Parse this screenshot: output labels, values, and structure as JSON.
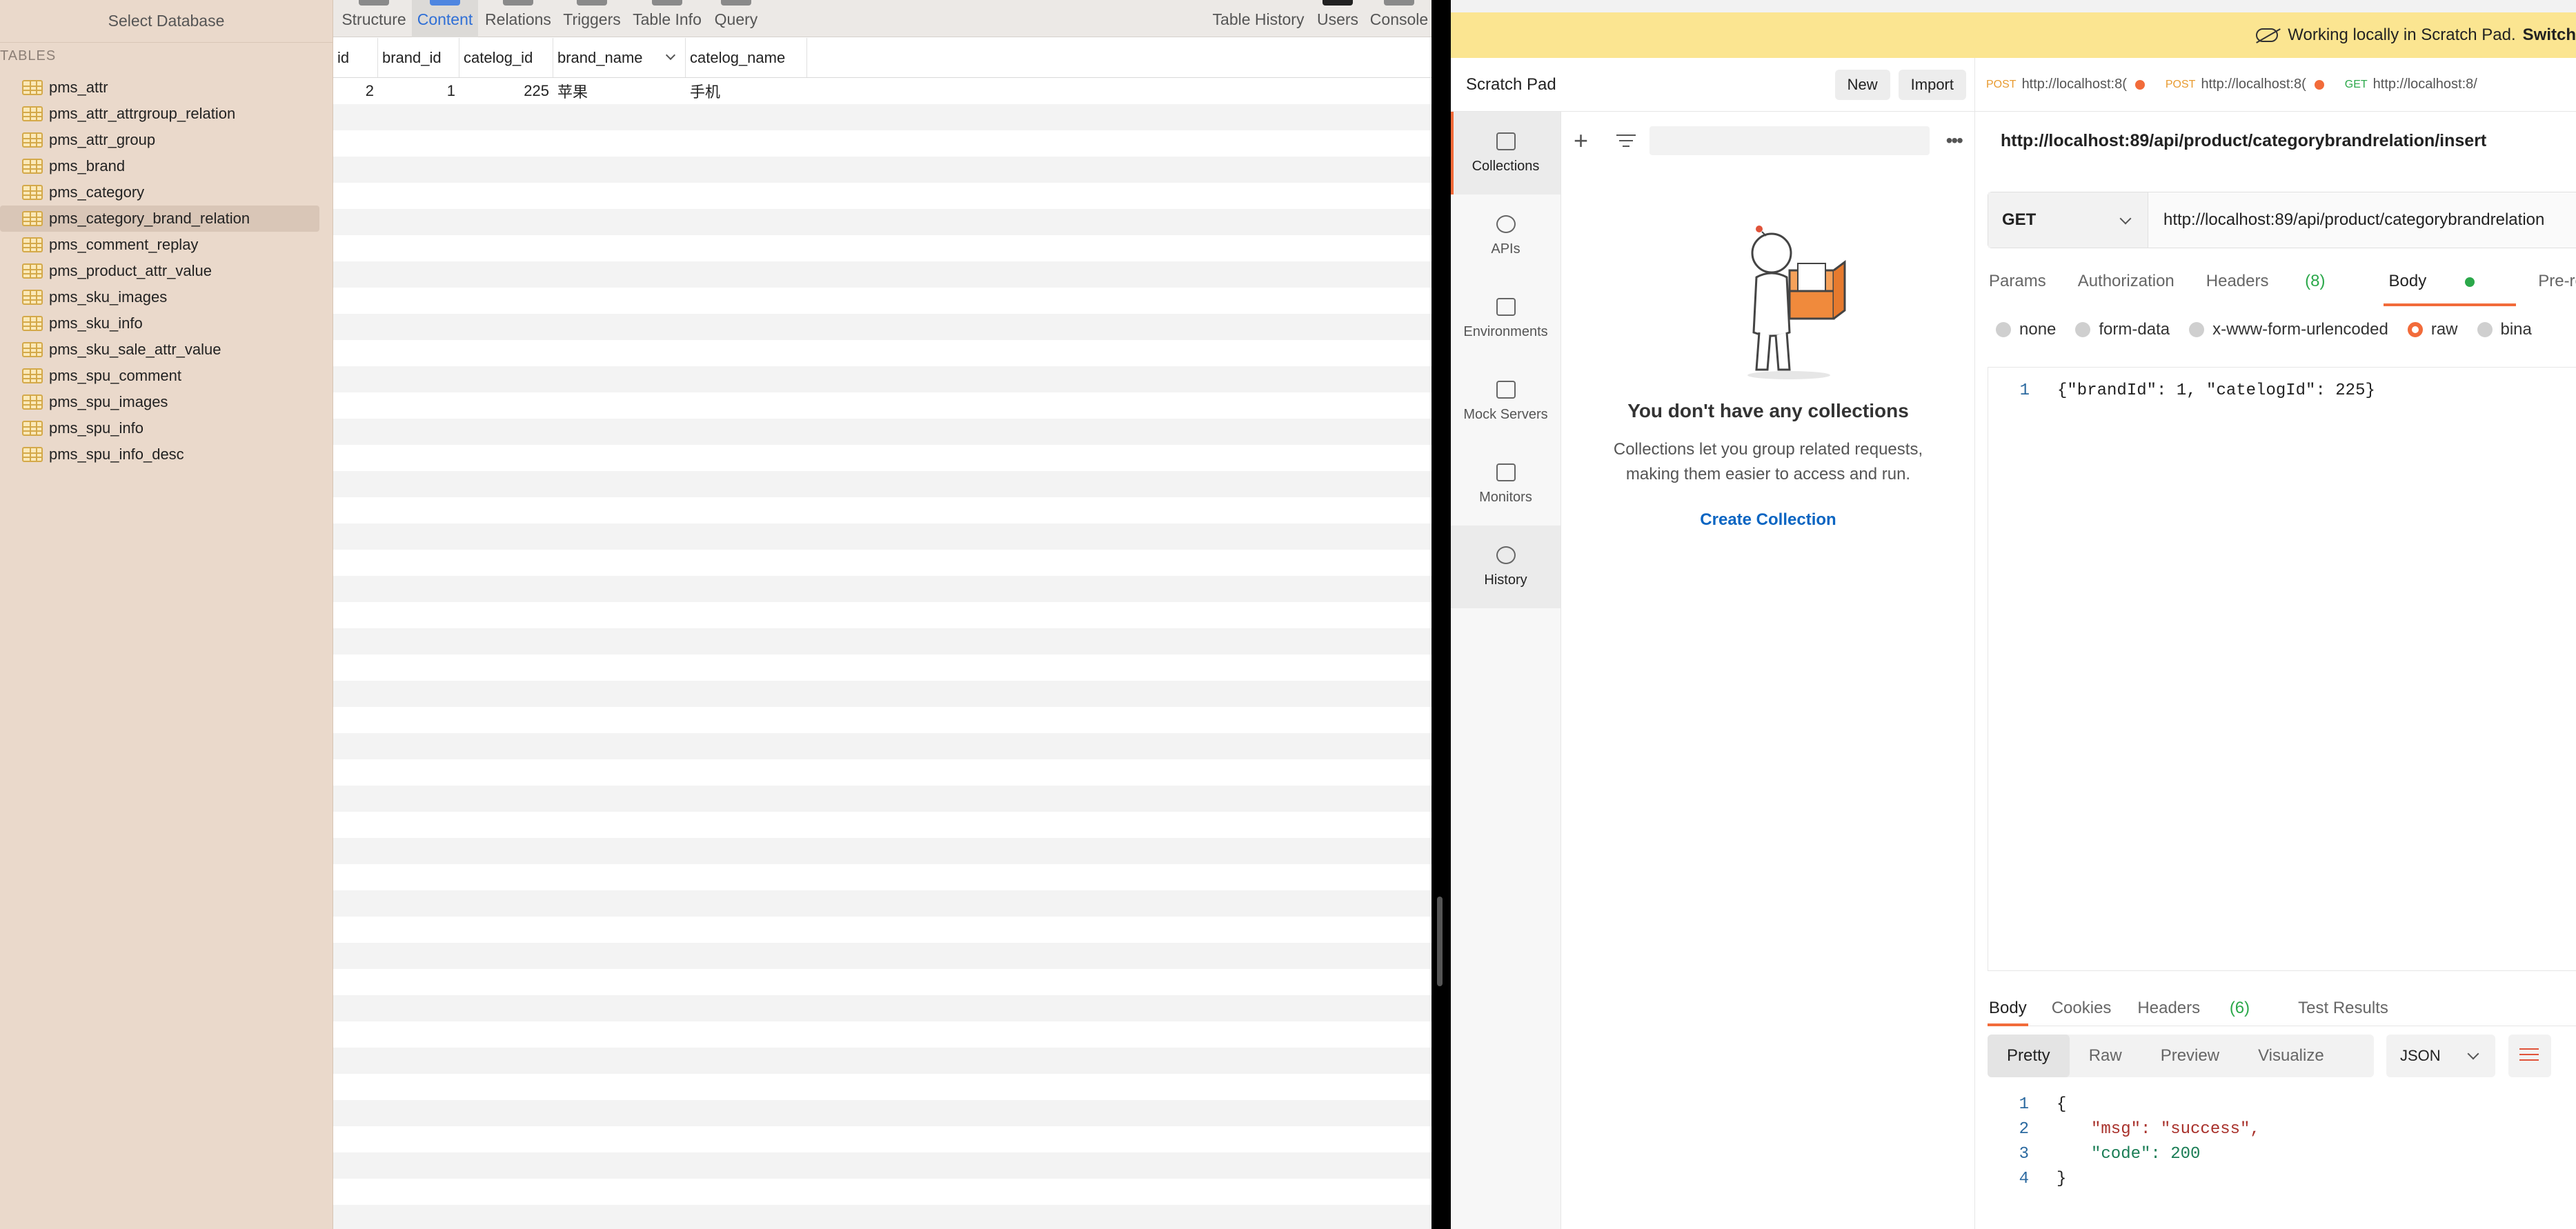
{
  "sequel": {
    "sidebar": {
      "select_database": "Select Database",
      "tables_header": "TABLES",
      "tables": [
        "pms_attr",
        "pms_attr_attrgroup_relation",
        "pms_attr_group",
        "pms_brand",
        "pms_category",
        "pms_category_brand_relation",
        "pms_comment_replay",
        "pms_product_attr_value",
        "pms_sku_images",
        "pms_sku_info",
        "pms_sku_sale_attr_value",
        "pms_spu_comment",
        "pms_spu_images",
        "pms_spu_info",
        "pms_spu_info_desc"
      ],
      "selected_table": "pms_category_brand_relation"
    },
    "toolbar": {
      "structure": "Structure",
      "content": "Content",
      "relations": "Relations",
      "triggers": "Triggers",
      "table_info": "Table Info",
      "query": "Query",
      "table_history": "Table History",
      "users": "Users",
      "console": "Console"
    },
    "grid": {
      "columns": [
        "id",
        "brand_id",
        "catelog_id",
        "brand_name",
        "catelog_name"
      ],
      "rows": [
        [
          "2",
          "1",
          "225",
          "苹果",
          "手机"
        ]
      ]
    }
  },
  "postman": {
    "banner": {
      "text": "Working locally in Scratch Pad.",
      "switch": "Switch"
    },
    "scratch_pad": {
      "title": "Scratch Pad",
      "new_label": "New",
      "import_label": "Import"
    },
    "nav": [
      {
        "label": "Collections",
        "icon": "collections-icon"
      },
      {
        "label": "APIs",
        "icon": "apis-icon"
      },
      {
        "label": "Environments",
        "icon": "environments-icon"
      },
      {
        "label": "Mock Servers",
        "icon": "mock-servers-icon"
      },
      {
        "label": "Monitors",
        "icon": "monitors-icon"
      },
      {
        "label": "History",
        "icon": "history-icon"
      }
    ],
    "collections": {
      "empty_title": "You don't have any collections",
      "empty_desc": "Collections let you group related requests, making them easier to access and run.",
      "create_label": "Create Collection"
    },
    "tabs": [
      {
        "method": "POST",
        "url": "http://localhost:8("
      },
      {
        "method": "POST",
        "url": "http://localhost:8("
      },
      {
        "method": "GET",
        "url": "http://localhost:8/"
      }
    ],
    "request": {
      "title": "http://localhost:89/api/product/categorybrandrelation/insert",
      "method": "GET",
      "url": "http://localhost:89/api/product/categorybrandrelation",
      "subtabs": {
        "params": "Params",
        "authorization": "Authorization",
        "headers": "Headers",
        "headers_count": "(8)",
        "body": "Body",
        "pre_request": "Pre-request Scrip"
      },
      "body_types": [
        "none",
        "form-data",
        "x-www-form-urlencoded",
        "raw",
        "bina"
      ],
      "selected_body_type": "raw",
      "body_line_number": "1",
      "body_text": "{\"brandId\": 1, \"catelogId\": 225}"
    },
    "response": {
      "tabs": {
        "body": "Body",
        "cookies": "Cookies",
        "headers": "Headers",
        "headers_count": "(6)",
        "test_results": "Test Results"
      },
      "formats": [
        "Pretty",
        "Raw",
        "Preview",
        "Visualize"
      ],
      "format_selected": "Pretty",
      "language": "JSON",
      "line_numbers": [
        "1",
        "2",
        "3",
        "4"
      ],
      "lines": [
        "{",
        "\"msg\": \"success\",",
        "\"code\": 200",
        "}"
      ]
    },
    "colors": {
      "accent": "#f26b3a",
      "banner_bg": "#fbe591",
      "link": "#0b65c2",
      "success_green": "#2ba84a"
    }
  }
}
